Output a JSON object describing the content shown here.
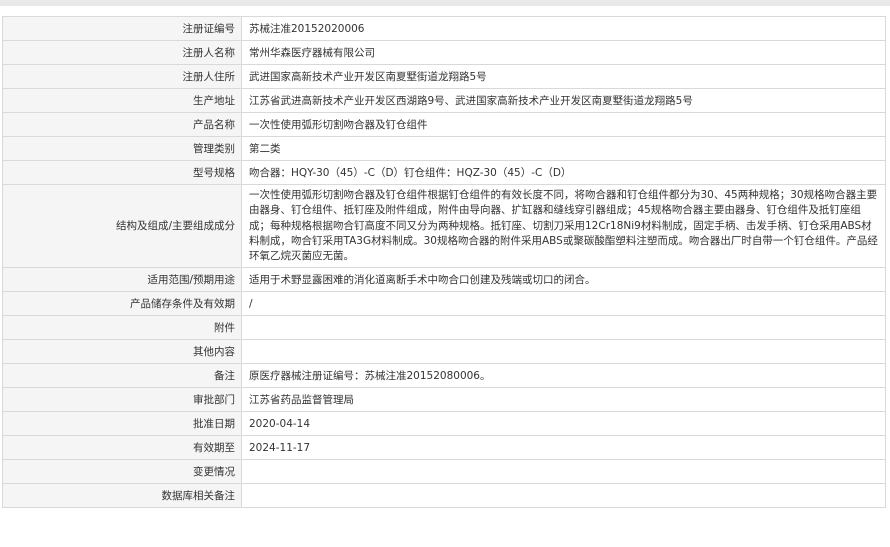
{
  "rows": [
    {
      "label": "注册证编号",
      "value": "苏械注准20152020006"
    },
    {
      "label": "注册人名称",
      "value": "常州华森医疗器械有限公司"
    },
    {
      "label": "注册人住所",
      "value": "武进国家高新技术产业开发区南夏墅街道龙翔路5号"
    },
    {
      "label": "生产地址",
      "value": "江苏省武进高新技术产业开发区西湖路9号、武进国家高新技术产业开发区南夏墅街道龙翔路5号"
    },
    {
      "label": "产品名称",
      "value": "一次性使用弧形切割吻合器及钉仓组件"
    },
    {
      "label": "管理类别",
      "value": "第二类"
    },
    {
      "label": "型号规格",
      "value": "吻合器：HQY-30（45）-C（D）钉仓组件：HQZ-30（45）-C（D）"
    },
    {
      "label": "结构及组成/主要组成成分",
      "value": "一次性使用弧形切割吻合器及钉仓组件根据钉仓组件的有效长度不同，将吻合器和钉仓组件都分为30、45两种规格；30规格吻合器主要由器身、钉仓组件、抵钉座及附件组成，附件由导向器、扩缸器和缝线穿引器组成；45规格吻合器主要由器身、钉仓组件及抵钉座组成；每种规格根据吻合钉高度不同又分为两种规格。抵钉座、切割刀采用12Cr18Ni9材料制成，固定手柄、击发手柄、钉仓采用ABS材料制成，吻合钉采用TA3G材料制成。30规格吻合器的附件采用ABS或聚碳酸酯塑料注塑而成。吻合器出厂时自带一个钉仓组件。产品经环氧乙烷灭菌应无菌。"
    },
    {
      "label": "适用范围/预期用途",
      "value": "适用于术野显露困难的消化道离断手术中吻合口创建及残端或切口的闭合。"
    },
    {
      "label": "产品储存条件及有效期",
      "value": "/"
    },
    {
      "label": "附件",
      "value": ""
    },
    {
      "label": "其他内容",
      "value": ""
    },
    {
      "label": "备注",
      "value": "原医疗器械注册证编号：苏械注准20152080006。"
    },
    {
      "label": "审批部门",
      "value": "江苏省药品监督管理局"
    },
    {
      "label": "批准日期",
      "value": "2020-04-14"
    },
    {
      "label": "有效期至",
      "value": "2024-11-17"
    },
    {
      "label": "变更情况",
      "value": ""
    },
    {
      "label": "数据库相关备注",
      "value": ""
    }
  ]
}
